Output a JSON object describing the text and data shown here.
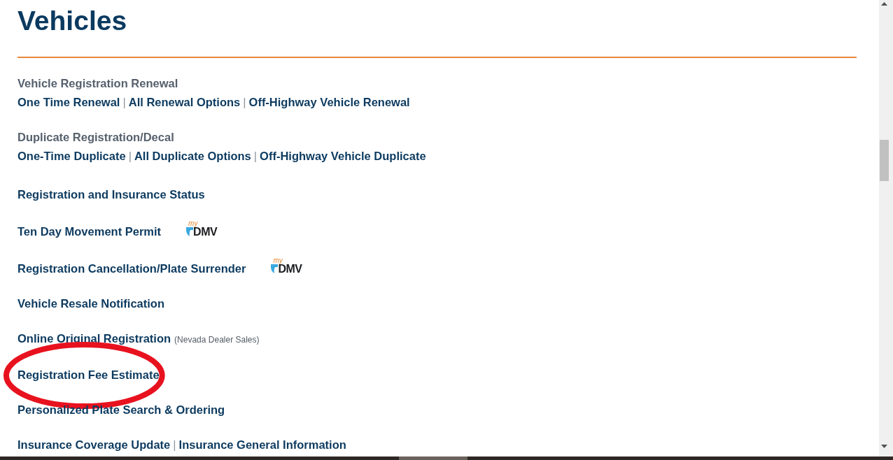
{
  "page": {
    "title": "Vehicles"
  },
  "items": [
    {
      "kind": "group",
      "label": "Vehicle Registration Renewal",
      "parts": [
        {
          "kind": "link",
          "text": "One Time Renewal"
        },
        {
          "kind": "separator",
          "text": "|"
        },
        {
          "kind": "link",
          "text": "All Renewal Options"
        },
        {
          "kind": "separator",
          "text": "|"
        },
        {
          "kind": "link",
          "text": "Off-Highway Vehicle Renewal"
        }
      ],
      "highlighted": false
    },
    {
      "kind": "group",
      "label": "Duplicate Registration/Decal",
      "parts": [
        {
          "kind": "link",
          "text": "One-Time Duplicate"
        },
        {
          "kind": "separator",
          "text": "|"
        },
        {
          "kind": "link",
          "text": "All Duplicate Options"
        },
        {
          "kind": "separator",
          "text": "|"
        },
        {
          "kind": "link",
          "text": "Off-Highway Vehicle Duplicate"
        }
      ],
      "highlighted": false
    },
    {
      "kind": "single",
      "parts": [
        {
          "kind": "link",
          "text": "Registration and Insurance Status"
        }
      ],
      "highlighted": false
    },
    {
      "kind": "single",
      "parts": [
        {
          "kind": "link",
          "text": "Ten Day Movement Permit"
        }
      ],
      "logo": {
        "script": "my",
        "wordmark": "DMV"
      },
      "highlighted": false
    },
    {
      "kind": "single",
      "parts": [
        {
          "kind": "link",
          "text": "Registration Cancellation/Plate Surrender"
        }
      ],
      "logo": {
        "script": "my",
        "wordmark": "DMV"
      },
      "highlighted": false
    },
    {
      "kind": "single",
      "parts": [
        {
          "kind": "link",
          "text": "Vehicle Resale Notification"
        }
      ],
      "highlighted": false
    },
    {
      "kind": "single",
      "parts": [
        {
          "kind": "link",
          "text": "Online Original Registration"
        }
      ],
      "note": "(Nevada Dealer Sales)",
      "highlighted": false
    },
    {
      "kind": "single",
      "parts": [
        {
          "kind": "link",
          "text": "Registration Fee Estimate"
        }
      ],
      "highlighted": true
    },
    {
      "kind": "single",
      "parts": [
        {
          "kind": "link",
          "text": "Personalized Plate Search & Ordering"
        }
      ],
      "highlighted": false
    },
    {
      "kind": "single",
      "parts": [
        {
          "kind": "link",
          "text": "Insurance Coverage Update"
        },
        {
          "kind": "separator",
          "text": "|"
        },
        {
          "kind": "link",
          "text": "Insurance General Information"
        }
      ],
      "highlighted": false
    }
  ]
}
